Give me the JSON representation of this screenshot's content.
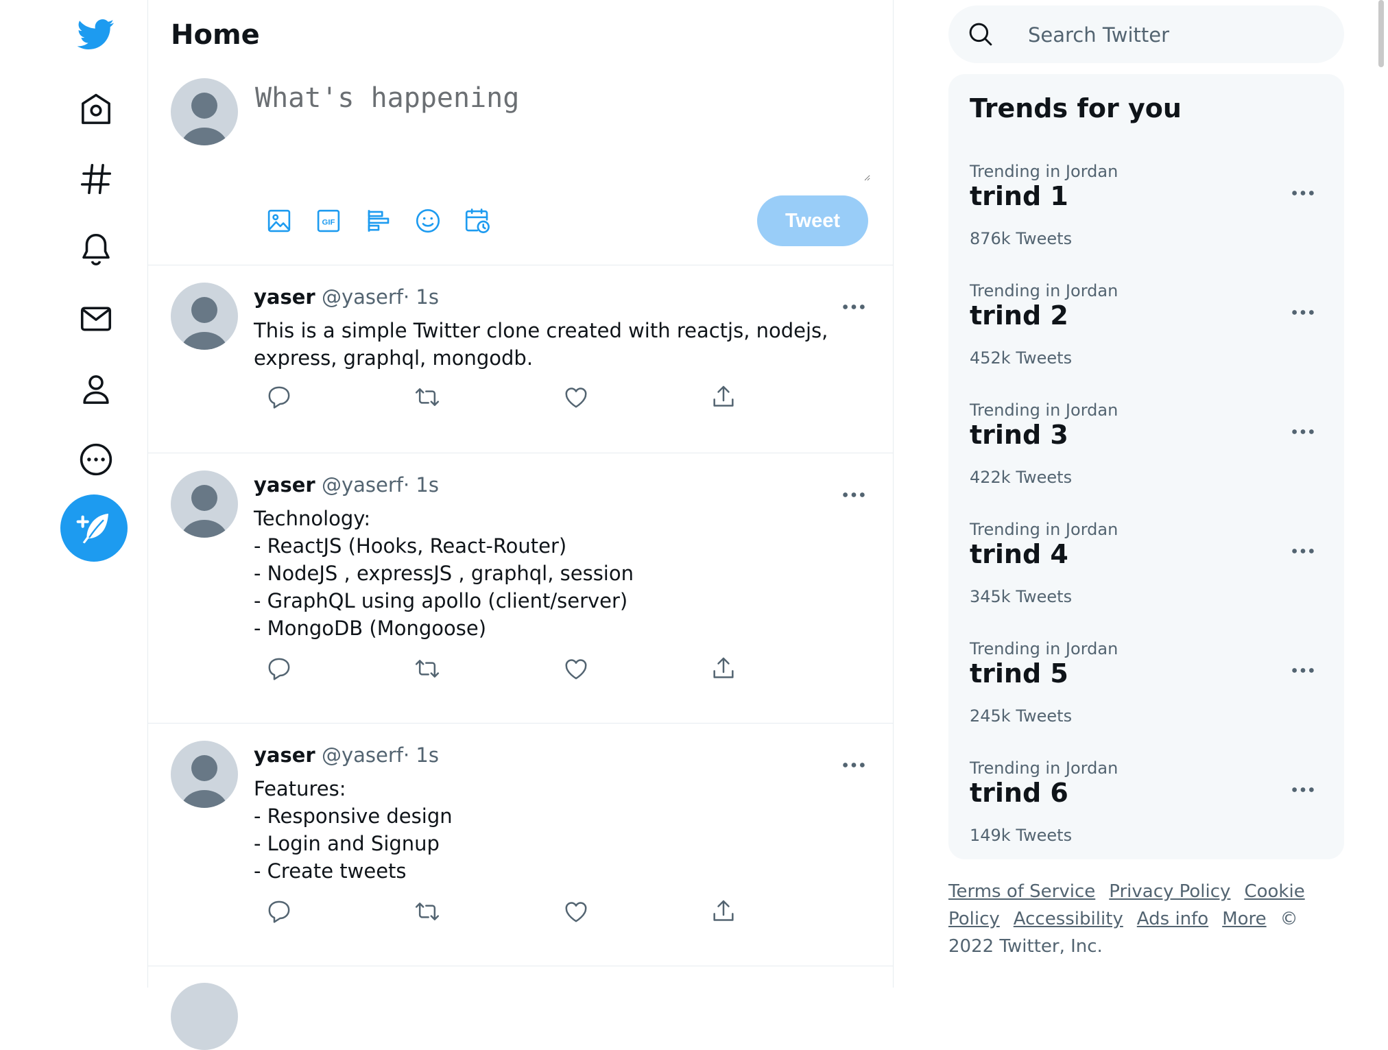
{
  "header": {
    "title": "Home"
  },
  "compose": {
    "placeholder": "What's happening",
    "tweet_button": "Tweet",
    "tools": [
      "image-icon",
      "gif-icon",
      "poll-icon",
      "emoji-icon",
      "schedule-icon"
    ]
  },
  "nav": {
    "items": [
      "twitter-logo-icon",
      "home-icon",
      "explore-hashtag-icon",
      "notifications-bell-icon",
      "messages-envelope-icon",
      "profile-person-icon",
      "more-circle-icon",
      "compose-tweet-icon"
    ]
  },
  "tweets": [
    {
      "name": "yaser",
      "handle": "@yaserf",
      "sep": "·",
      "time": "1s",
      "text": "This is a simple Twitter clone created with reactjs, nodejs, express, graphql, mongodb."
    },
    {
      "name": "yaser",
      "handle": "@yaserf",
      "sep": "·",
      "time": "1s",
      "text": "Technology:\n- ReactJS (Hooks, React-Router)\n- NodeJS , expressJS , graphql, session\n- GraphQL using apollo (client/server)\n- MongoDB (Mongoose)"
    },
    {
      "name": "yaser",
      "handle": "@yaserf",
      "sep": "·",
      "time": "1s",
      "text": "Features:\n- Responsive design\n- Login and Signup\n- Create tweets"
    }
  ],
  "search": {
    "placeholder": "Search Twitter"
  },
  "trends": {
    "title": "Trends for you",
    "items": [
      {
        "context": "Trending in Jordan",
        "name": "trind 1",
        "count": "876k Tweets"
      },
      {
        "context": "Trending in Jordan",
        "name": "trind 2",
        "count": "452k Tweets"
      },
      {
        "context": "Trending in Jordan",
        "name": "trind 3",
        "count": "422k Tweets"
      },
      {
        "context": "Trending in Jordan",
        "name": "trind 4",
        "count": "345k Tweets"
      },
      {
        "context": "Trending in Jordan",
        "name": "trind 5",
        "count": "245k Tweets"
      },
      {
        "context": "Trending in Jordan",
        "name": "trind 6",
        "count": "149k Tweets"
      }
    ]
  },
  "footer": {
    "links": [
      "Terms of Service",
      "Privacy Policy",
      "Cookie Policy",
      "Accessibility",
      "Ads info",
      "More"
    ],
    "copyright": "© 2022 Twitter, Inc."
  },
  "colors": {
    "accent": "#1d9bf0",
    "tweet_button_disabled": "#99cdf8",
    "muted_text": "#536471",
    "panel_bg": "#f5f8fa"
  }
}
